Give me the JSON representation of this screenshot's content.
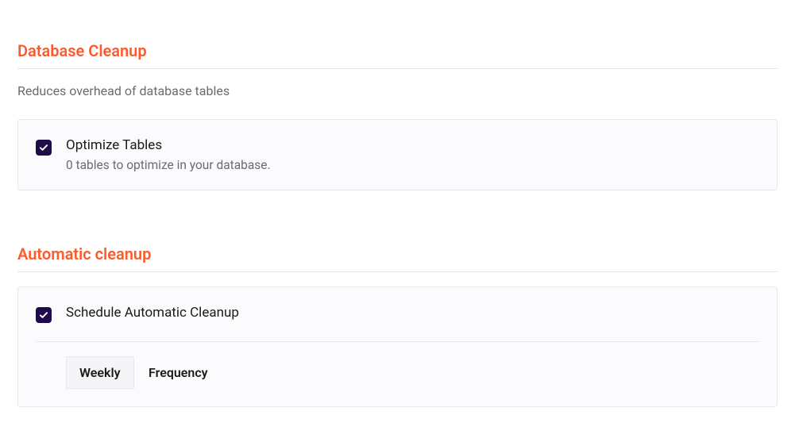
{
  "sections": {
    "database_cleanup": {
      "title": "Database Cleanup",
      "description": "Reduces overhead of database tables",
      "optimize": {
        "label": "Optimize Tables",
        "sub": "0 tables to optimize in your database.",
        "checked": true
      }
    },
    "automatic_cleanup": {
      "title": "Automatic cleanup",
      "schedule": {
        "label": "Schedule Automatic Cleanup",
        "checked": true
      },
      "frequency": {
        "value": "Weekly",
        "label": "Frequency"
      }
    }
  }
}
